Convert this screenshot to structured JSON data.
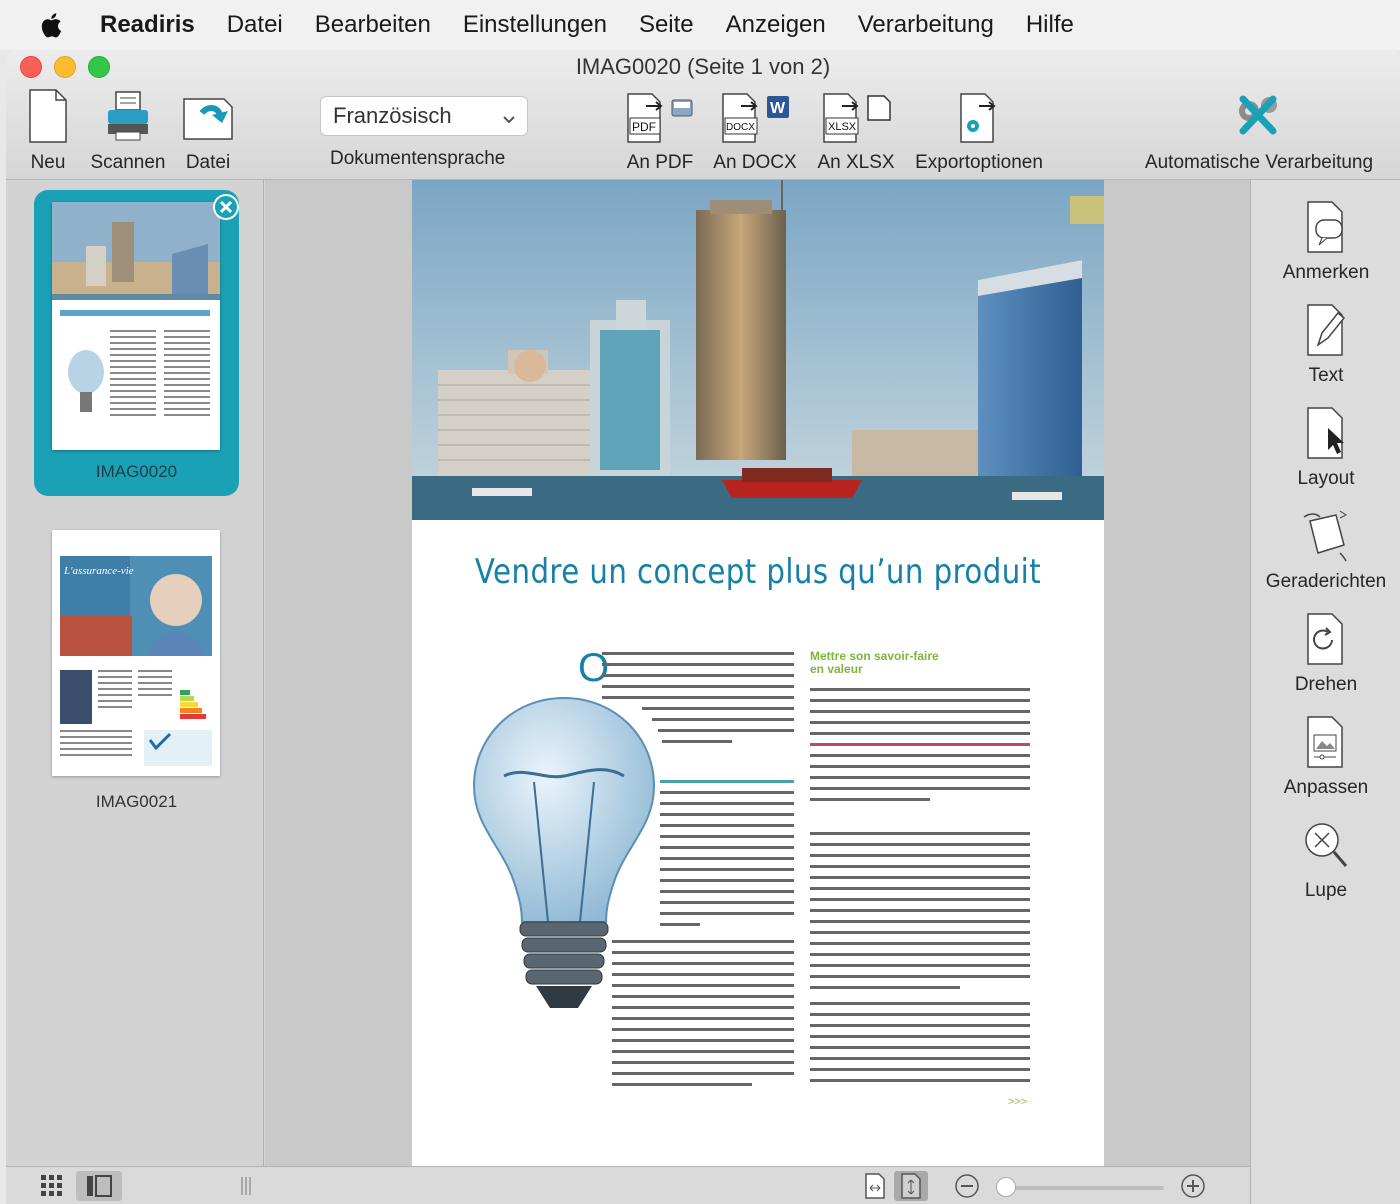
{
  "menubar": {
    "app_name": "Readiris",
    "items": [
      "Datei",
      "Bearbeiten",
      "Einstellungen",
      "Seite",
      "Anzeigen",
      "Verarbeitung",
      "Hilfe"
    ]
  },
  "window": {
    "title": "IMAG0020 (Seite 1 von 2)"
  },
  "toolbar": {
    "new_label": "Neu",
    "scan_label": "Scannen",
    "file_label": "Datei",
    "language_value": "Französisch",
    "language_label": "Dokumentensprache",
    "to_pdf_label": "An PDF",
    "to_docx_label": "An DOCX",
    "to_xlsx_label": "An XLSX",
    "export_options_label": "Exportoptionen",
    "auto_processing_label": "Automatische Verarbeitung",
    "pdf_tag": "PDF",
    "docx_tag": "DOCX",
    "xlsx_tag": "XLSX"
  },
  "thumbnails": [
    {
      "label": "IMAG0020",
      "selected": true
    },
    {
      "label": "IMAG0021",
      "selected": false
    }
  ],
  "document": {
    "headline": "Vendre un concept plus qu’un produit",
    "dropcap": "O",
    "subhead_line1": "Mettre son savoir-faire",
    "subhead_line2": "en valeur",
    "more_marker": ">>>"
  },
  "right_panel": {
    "annotate_label": "Anmerken",
    "text_label": "Text",
    "layout_label": "Layout",
    "straighten_label": "Geraderichten",
    "rotate_label": "Drehen",
    "adjust_label": "Anpassen",
    "magnifier_label": "Lupe"
  },
  "colors": {
    "accent_teal": "#1aa1b6",
    "headline_blue": "#1680a8",
    "subhead_green": "#7db63a"
  }
}
